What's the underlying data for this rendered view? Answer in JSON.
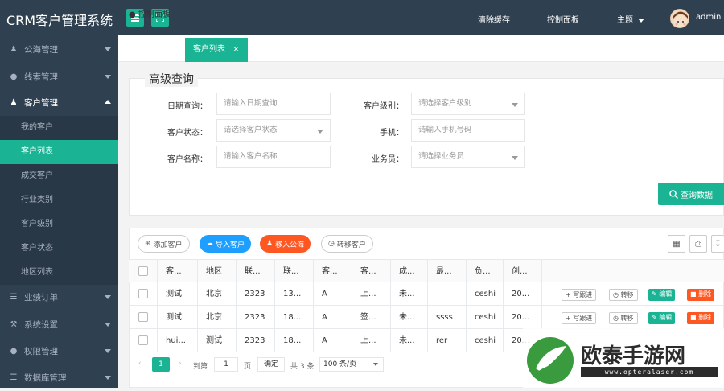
{
  "app": {
    "title": "CRM客户管理系统"
  },
  "topbar": {
    "clear_cache": "清除缓存",
    "dashboard": "控制面板",
    "theme": "主题",
    "user": "admin"
  },
  "sidebar": {
    "items": [
      {
        "label": "公海管理",
        "icon": "user-icon"
      },
      {
        "label": "线索管理",
        "icon": "globe-icon"
      },
      {
        "label": "客户管理",
        "icon": "user-icon"
      },
      {
        "label": "业绩订单",
        "icon": "database-icon"
      },
      {
        "label": "系统设置",
        "icon": "wrench-icon"
      },
      {
        "label": "权限管理",
        "icon": "globe-icon"
      },
      {
        "label": "数据库管理",
        "icon": "database-icon"
      }
    ],
    "subitems": [
      "我的客户",
      "客户列表",
      "成交客户",
      "行业类别",
      "客户级别",
      "客户状态",
      "地区列表"
    ]
  },
  "tabs": {
    "home": "控制面板",
    "current": "客户列表"
  },
  "search": {
    "legend": "高级查询",
    "date_label": "日期查询：",
    "date_placeholder": "请输入日期查询",
    "level_label": "客户级别：",
    "level_placeholder": "请选择客户级别",
    "status_label": "客户状态：",
    "status_placeholder": "请选择客户状态",
    "phone_label": "手机：",
    "phone_placeholder": "请输入手机号码",
    "name_label": "客户名称：",
    "name_placeholder": "请输入客户名称",
    "sales_label": "业务员：",
    "sales_placeholder": "请选择业务员",
    "query_button": "查询数据"
  },
  "toolbar": {
    "add": "添加客户",
    "import": "导入客户",
    "to_pool": "移入公海",
    "transfer": "转移客户"
  },
  "table": {
    "headers": [
      "客...",
      "地区",
      "联...",
      "联...",
      "客...",
      "客...",
      "成...",
      "最...",
      "负...",
      "创..."
    ],
    "rows": [
      [
        "测试",
        "北京",
        "2323",
        "13...",
        "A",
        "上...",
        "未...",
        "",
        "ceshi",
        "20..."
      ],
      [
        "测试",
        "北京",
        "2323",
        "18...",
        "A",
        "签...",
        "未...",
        "ssss",
        "ceshi",
        "20..."
      ],
      [
        "hui...",
        "测试",
        "2323",
        "18...",
        "A",
        "上...",
        "未...",
        "rer",
        "ceshi",
        "20..."
      ]
    ],
    "actions": {
      "follow": "写跟进",
      "transfer": "转移",
      "edit": "编辑",
      "delete": "删除"
    }
  },
  "pagination": {
    "current": "1",
    "goto_prefix": "到第",
    "goto_value": "1",
    "goto_suffix": "页",
    "confirm": "确定",
    "total": "共 3 条",
    "per_page": "100 条/页"
  },
  "watermark": {
    "text": "欧泰手游网",
    "url": "www.opteralaser.com"
  },
  "colors": {
    "sidebar": "#2f4050",
    "accent": "#1ab394",
    "blue": "#1e9fff",
    "orange": "#ff5722"
  }
}
